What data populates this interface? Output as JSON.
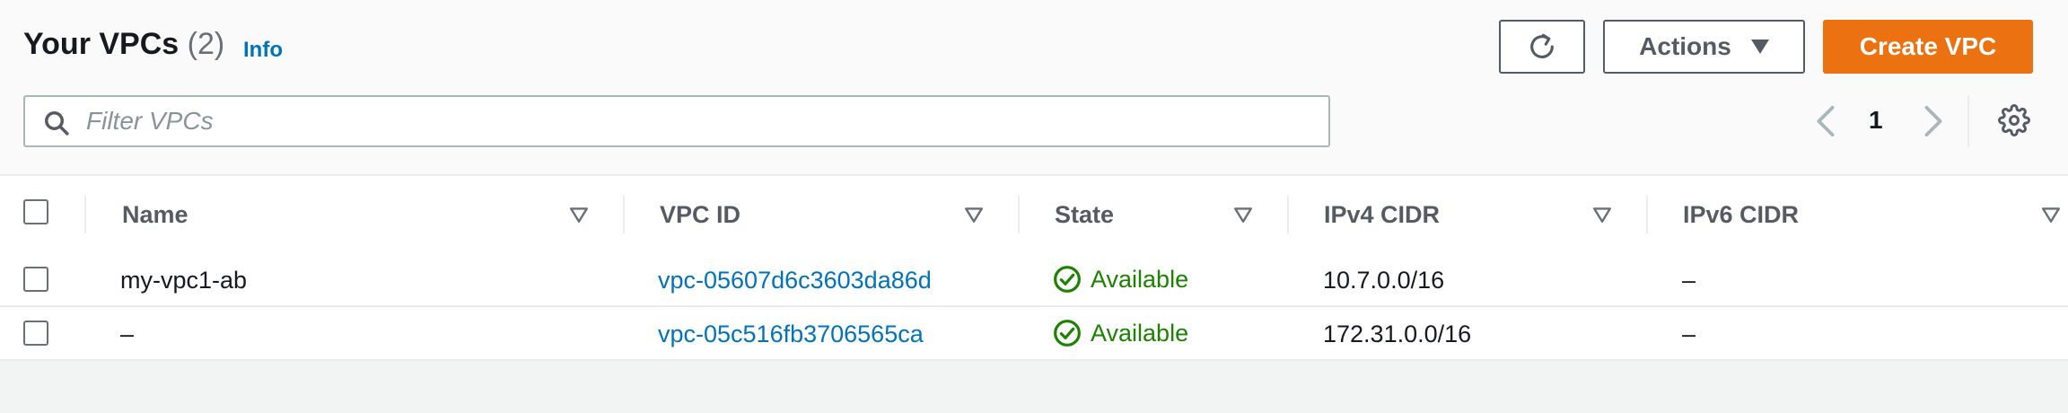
{
  "header": {
    "title": "Your VPCs",
    "count": "(2)",
    "info_link": "Info",
    "actions_label": "Actions",
    "create_label": "Create VPC"
  },
  "filter": {
    "placeholder": "Filter VPCs",
    "value": ""
  },
  "pagination": {
    "current_page": "1"
  },
  "table": {
    "columns": [
      "Name",
      "VPC ID",
      "State",
      "IPv4 CIDR",
      "IPv6 CIDR"
    ],
    "rows": [
      {
        "name": "my-vpc1-ab",
        "vpc_id": "vpc-05607d6c3603da86d",
        "state": "Available",
        "ipv4": "10.7.0.0/16",
        "ipv6": "–"
      },
      {
        "name": "–",
        "vpc_id": "vpc-05c516fb3706565ca",
        "state": "Available",
        "ipv4": "172.31.0.0/16",
        "ipv6": "–"
      }
    ]
  },
  "colors": {
    "accent": "#ec7211",
    "link": "#0073bb",
    "success": "#1d8102"
  },
  "icons": [
    "refresh-icon",
    "caret-down-icon",
    "search-icon",
    "chevron-left-icon",
    "chevron-right-icon",
    "gear-icon",
    "sort-icon",
    "check-circle-icon"
  ]
}
